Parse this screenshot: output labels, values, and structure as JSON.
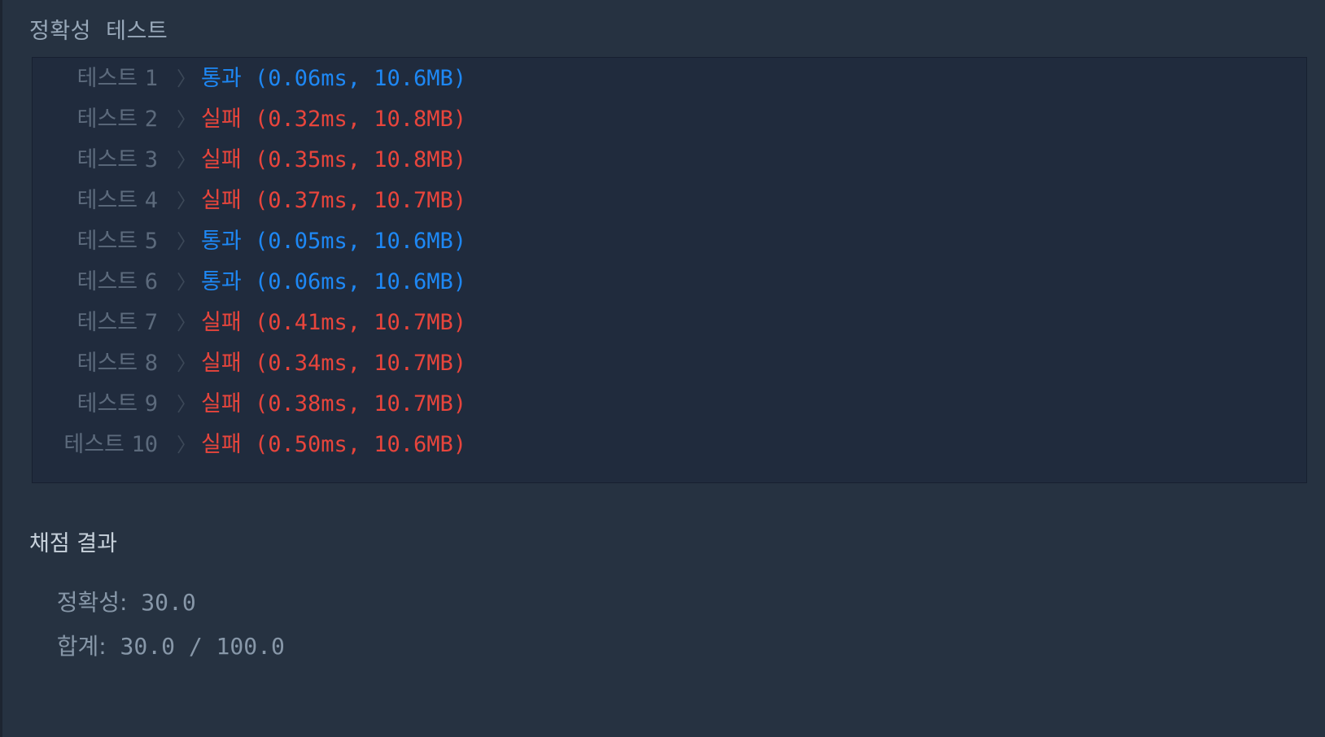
{
  "section": {
    "title": "정확성  테스트"
  },
  "tests": [
    {
      "label": "테스트",
      "num": "1",
      "status": "통과",
      "detail": " (0.06ms, 10.6MB)",
      "state": "pass"
    },
    {
      "label": "테스트",
      "num": "2",
      "status": "실패",
      "detail": " (0.32ms, 10.8MB)",
      "state": "fail"
    },
    {
      "label": "테스트",
      "num": "3",
      "status": "실패",
      "detail": " (0.35ms, 10.8MB)",
      "state": "fail"
    },
    {
      "label": "테스트",
      "num": "4",
      "status": "실패",
      "detail": " (0.37ms, 10.7MB)",
      "state": "fail"
    },
    {
      "label": "테스트",
      "num": "5",
      "status": "통과",
      "detail": " (0.05ms, 10.6MB)",
      "state": "pass"
    },
    {
      "label": "테스트",
      "num": "6",
      "status": "통과",
      "detail": " (0.06ms, 10.6MB)",
      "state": "pass"
    },
    {
      "label": "테스트",
      "num": "7",
      "status": "실패",
      "detail": " (0.41ms, 10.7MB)",
      "state": "fail"
    },
    {
      "label": "테스트",
      "num": "8",
      "status": "실패",
      "detail": " (0.34ms, 10.7MB)",
      "state": "fail"
    },
    {
      "label": "테스트",
      "num": "9",
      "status": "실패",
      "detail": " (0.38ms, 10.7MB)",
      "state": "fail"
    },
    {
      "label": "테스트",
      "num": "10",
      "status": "실패",
      "detail": " (0.50ms, 10.6MB)",
      "state": "fail"
    }
  ],
  "chevron": "〉",
  "score": {
    "title": "채점 결과",
    "accuracy_label": "정확성:",
    "accuracy_value": " 30.0",
    "total_label": "합계:",
    "total_value": " 30.0 / 100.0"
  },
  "colors": {
    "pass": "#1e88f5",
    "fail": "#e8453c"
  }
}
